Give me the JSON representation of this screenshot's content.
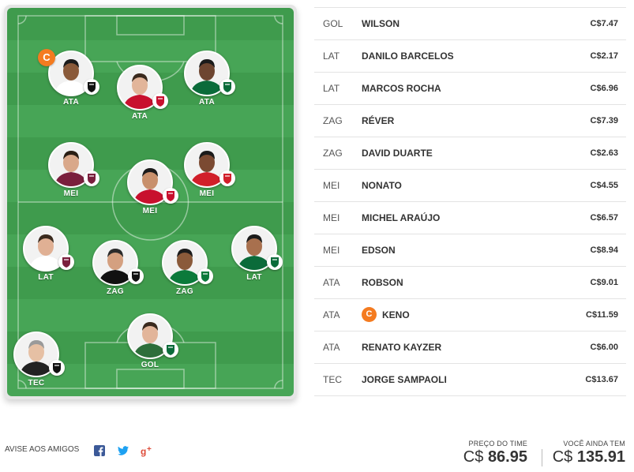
{
  "formation": {
    "players": [
      {
        "pos": "ATA",
        "captain": true,
        "club": "Atletico-MG",
        "club_color": "#111111"
      },
      {
        "pos": "ATA",
        "captain": false,
        "club": "Athletico-PR",
        "club_color": "#c8102e"
      },
      {
        "pos": "ATA",
        "captain": false,
        "club": "Coritiba",
        "club_color": "#0b6b3a"
      },
      {
        "pos": "MEI",
        "captain": false,
        "club": "Fluminense",
        "club_color": "#7a1f3d"
      },
      {
        "pos": "MEI",
        "captain": false,
        "club": "Atletico-GO",
        "club_color": "#c8102e"
      },
      {
        "pos": "MEI",
        "captain": false,
        "club": "Internacional",
        "club_color": "#d11f2a"
      },
      {
        "pos": "LAT",
        "captain": false,
        "club": "Fluminense",
        "club_color": "#7a1f3d"
      },
      {
        "pos": "ZAG",
        "captain": false,
        "club": "Atletico-MG",
        "club_color": "#111111"
      },
      {
        "pos": "ZAG",
        "captain": false,
        "club": "Goias",
        "club_color": "#0b7a3b"
      },
      {
        "pos": "LAT",
        "captain": false,
        "club": "Palmeiras",
        "club_color": "#0b6b3a"
      },
      {
        "pos": "GOL",
        "captain": false,
        "club": "Coritiba",
        "club_color": "#0b6b3a"
      },
      {
        "pos": "TEC",
        "captain": false,
        "club": "Atletico-MG",
        "club_color": "#111111"
      }
    ],
    "captain_symbol": "C"
  },
  "lineup": [
    {
      "pos": "GOL",
      "name": "WILSON",
      "price": "C$7.47"
    },
    {
      "pos": "LAT",
      "name": "DANILO BARCELOS",
      "price": "C$2.17"
    },
    {
      "pos": "LAT",
      "name": "MARCOS ROCHA",
      "price": "C$6.96"
    },
    {
      "pos": "ZAG",
      "name": "RÉVER",
      "price": "C$7.39"
    },
    {
      "pos": "ZAG",
      "name": "DAVID DUARTE",
      "price": "C$2.63"
    },
    {
      "pos": "MEI",
      "name": "NONATO",
      "price": "C$4.55"
    },
    {
      "pos": "MEI",
      "name": "MICHEL ARAÚJO",
      "price": "C$6.57"
    },
    {
      "pos": "MEI",
      "name": "EDSON",
      "price": "C$8.94"
    },
    {
      "pos": "ATA",
      "name": "ROBSON",
      "price": "C$9.01"
    },
    {
      "pos": "ATA",
      "name": "KENO",
      "price": "C$11.59",
      "captain": true
    },
    {
      "pos": "ATA",
      "name": "RENATO KAYZER",
      "price": "C$6.00"
    },
    {
      "pos": "TEC",
      "name": "JORGE SAMPAOLI",
      "price": "C$13.67"
    }
  ],
  "footer": {
    "share_label": "AVISE AOS AMIGOS",
    "social_icons": [
      "facebook-icon",
      "twitter-icon",
      "google-plus-icon"
    ],
    "social_colors": {
      "facebook": "#3b5998",
      "twitter": "#1da1f2",
      "google_plus": "#dd4b39"
    },
    "team_price_label": "PREÇO DO TIME",
    "team_price_currency": "C$",
    "team_price_value": "86.95",
    "remaining_label": "VOCÊ AINDA TEM",
    "remaining_currency": "C$",
    "remaining_value": "135.91"
  },
  "colors": {
    "captain": "#f47b20",
    "field_dark": "#3f9b4d",
    "field_light": "#47a556"
  }
}
